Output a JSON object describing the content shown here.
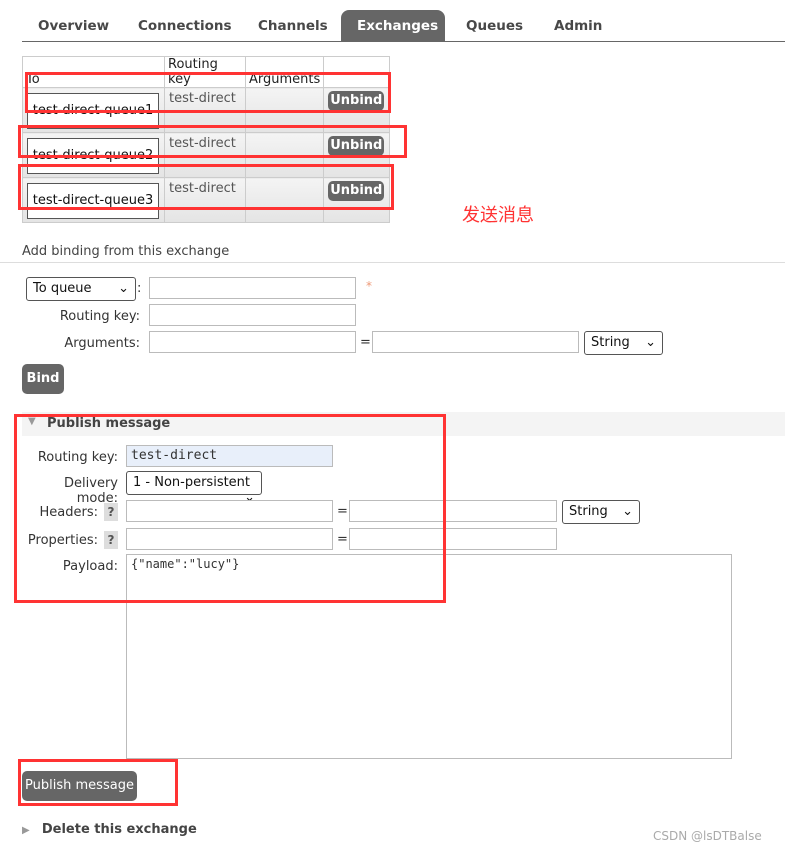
{
  "tabs": [
    "Overview",
    "Connections",
    "Channels",
    "Exchanges",
    "Queues",
    "Admin"
  ],
  "bindings": {
    "headers": [
      "To",
      "Routing key",
      "Arguments",
      ""
    ],
    "rows": [
      {
        "to": "test-direct-queue1",
        "key": "test-direct",
        "action": "Unbind"
      },
      {
        "to": "test-direct-queue2",
        "key": "test-direct",
        "action": "Unbind"
      },
      {
        "to": "test-direct-queue3",
        "key": "test-direct",
        "action": "Unbind"
      }
    ]
  },
  "annotation": "发送消息",
  "add_binding": {
    "title": "Add binding from this exchange",
    "dest_type": "To queue",
    "required_mark": "*",
    "routing_key_label": "Routing key:",
    "arguments_label": "Arguments:",
    "colon": ":",
    "eq": "=",
    "arg_type": "String",
    "bind_label": "Bind"
  },
  "publish": {
    "title": "Publish message",
    "routing_key_label": "Routing key:",
    "routing_key": "test-direct",
    "delivery_mode_label": "Delivery mode:",
    "delivery_mode": "1 - Non-persistent",
    "headers_label": "Headers:",
    "properties_label": "Properties:",
    "help": "?",
    "eq": "=",
    "header_type": "String",
    "payload_label": "Payload:",
    "payload": "{\"name\":\"lucy\"}",
    "button": "Publish message"
  },
  "delete_section": "Delete this exchange",
  "watermark": "CSDN @lsDTBalse",
  "colors": {
    "accent": "#666666",
    "highlight": "#ff3333"
  }
}
